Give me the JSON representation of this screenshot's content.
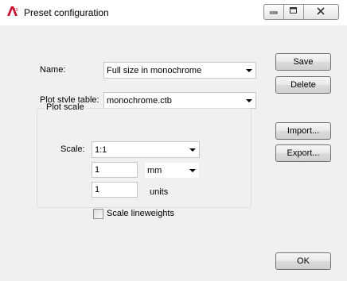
{
  "window": {
    "title": "Preset configuration",
    "app_icon": "autocad-icon",
    "controls": {
      "minimize_icon": "minimize-icon",
      "maximize_icon": "maximize-icon",
      "close_icon": "close-icon"
    }
  },
  "form": {
    "name_label": "Name:",
    "name_value": "Full size in monochrome",
    "plot_style_label": "Plot style table:",
    "plot_style_value": "monochrome.ctb"
  },
  "plot_scale": {
    "group_title": "Plot scale",
    "scale_label": "Scale:",
    "scale_value": "1:1",
    "paper_value": "1",
    "paper_unit": "mm",
    "drawing_value": "1",
    "drawing_unit": "units",
    "scale_lineweights_label": "Scale lineweights",
    "scale_lineweights_checked": false
  },
  "buttons": {
    "save": "Save",
    "delete": "Delete",
    "import": "Import...",
    "export": "Export...",
    "ok": "OK"
  }
}
